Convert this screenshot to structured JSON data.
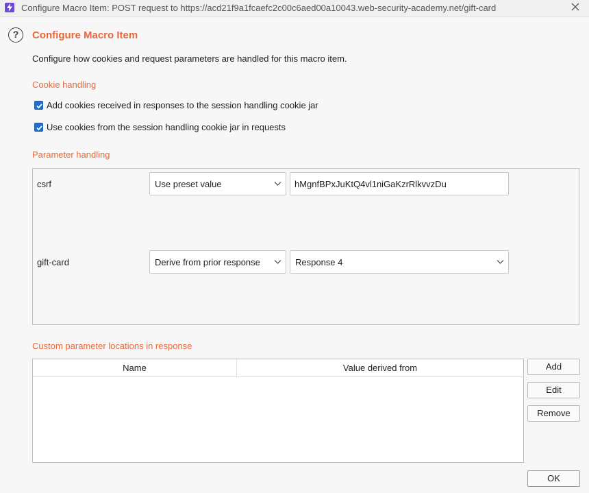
{
  "window": {
    "title": "Configure Macro Item: POST request to https://acd21f9a1fcaefc2c00c6aed00a10043.web-security-academy.net/gift-card"
  },
  "dialog": {
    "heading": "Configure Macro Item",
    "description": "Configure how cookies and request parameters are handled for this macro item."
  },
  "cookie_handling": {
    "title": "Cookie handling",
    "options": [
      {
        "label": "Add cookies received in responses to the session handling cookie jar",
        "checked": true
      },
      {
        "label": "Use cookies from the session handling cookie jar in requests",
        "checked": true
      }
    ]
  },
  "parameter_handling": {
    "title": "Parameter handling",
    "params": [
      {
        "name": "csrf",
        "mode": "Use preset value",
        "value": "hMgnfBPxJuKtQ4vl1niGaKzrRlkvvzDu"
      },
      {
        "name": "gift-card",
        "mode": "Derive from prior response",
        "value": "Response 4"
      }
    ]
  },
  "custom_locations": {
    "title": "Custom parameter locations in response",
    "columns": [
      "Name",
      "Value derived from"
    ],
    "rows": []
  },
  "buttons": {
    "add": "Add",
    "edit": "Edit",
    "remove": "Remove",
    "ok": "OK"
  }
}
